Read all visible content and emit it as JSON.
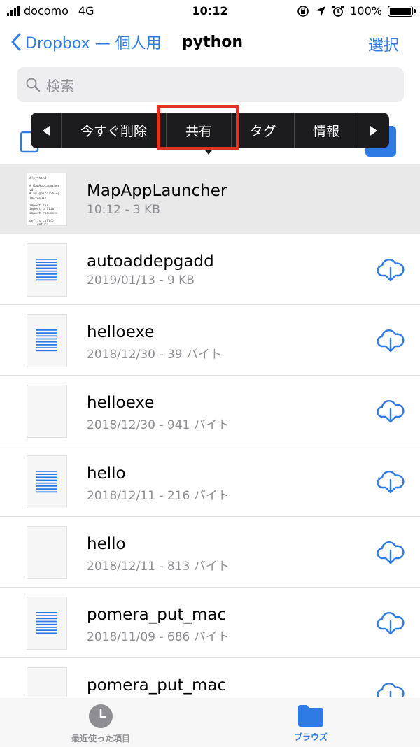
{
  "status_bar": {
    "carrier": "docomo",
    "network": "4G",
    "time": "10:12",
    "battery": "100%"
  },
  "nav": {
    "back_label": "Dropbox — 個人用",
    "title": "python",
    "select_label": "選択"
  },
  "search": {
    "placeholder": "検索"
  },
  "context_menu": {
    "items": [
      "今すぐ削除",
      "共有",
      "タグ",
      "情報"
    ],
    "highlighted": "共有"
  },
  "files": [
    {
      "name": "MapAppLauncher",
      "meta": "10:12 - 3 KB",
      "selected": true,
      "preview": "#!python3\n\n# MapAppLauncher\nv0.1\n# by @hitoriblog\n(miyasht)\n\nimport sys\nimport urllib\nimport requests\n\ndef is_cell():\n    return"
    },
    {
      "name": "autoaddepgadd",
      "meta": "2019/01/13 - 9 KB",
      "thumb": "lines"
    },
    {
      "name": "helloexe",
      "meta": "2018/12/30 - 39 バイト",
      "thumb": "lines"
    },
    {
      "name": "helloexe",
      "meta": "2018/12/30 - 941 バイト",
      "thumb": "blank"
    },
    {
      "name": "hello",
      "meta": "2018/12/11 - 216 バイト",
      "thumb": "lines"
    },
    {
      "name": "hello",
      "meta": "2018/12/11 - 813 バイト",
      "thumb": "blank"
    },
    {
      "name": "pomera_put_mac",
      "meta": "2018/11/09 - 686 バイト",
      "thumb": "lines"
    },
    {
      "name": "pomera_put_mac",
      "meta": "",
      "thumb": "blank"
    }
  ],
  "tab_bar": {
    "recent_label": "最近使った項目",
    "browse_label": "ブラウズ"
  },
  "colors": {
    "accent": "#2f7be6",
    "highlight": "#e03323",
    "menu_bg": "#1c1c1e"
  }
}
